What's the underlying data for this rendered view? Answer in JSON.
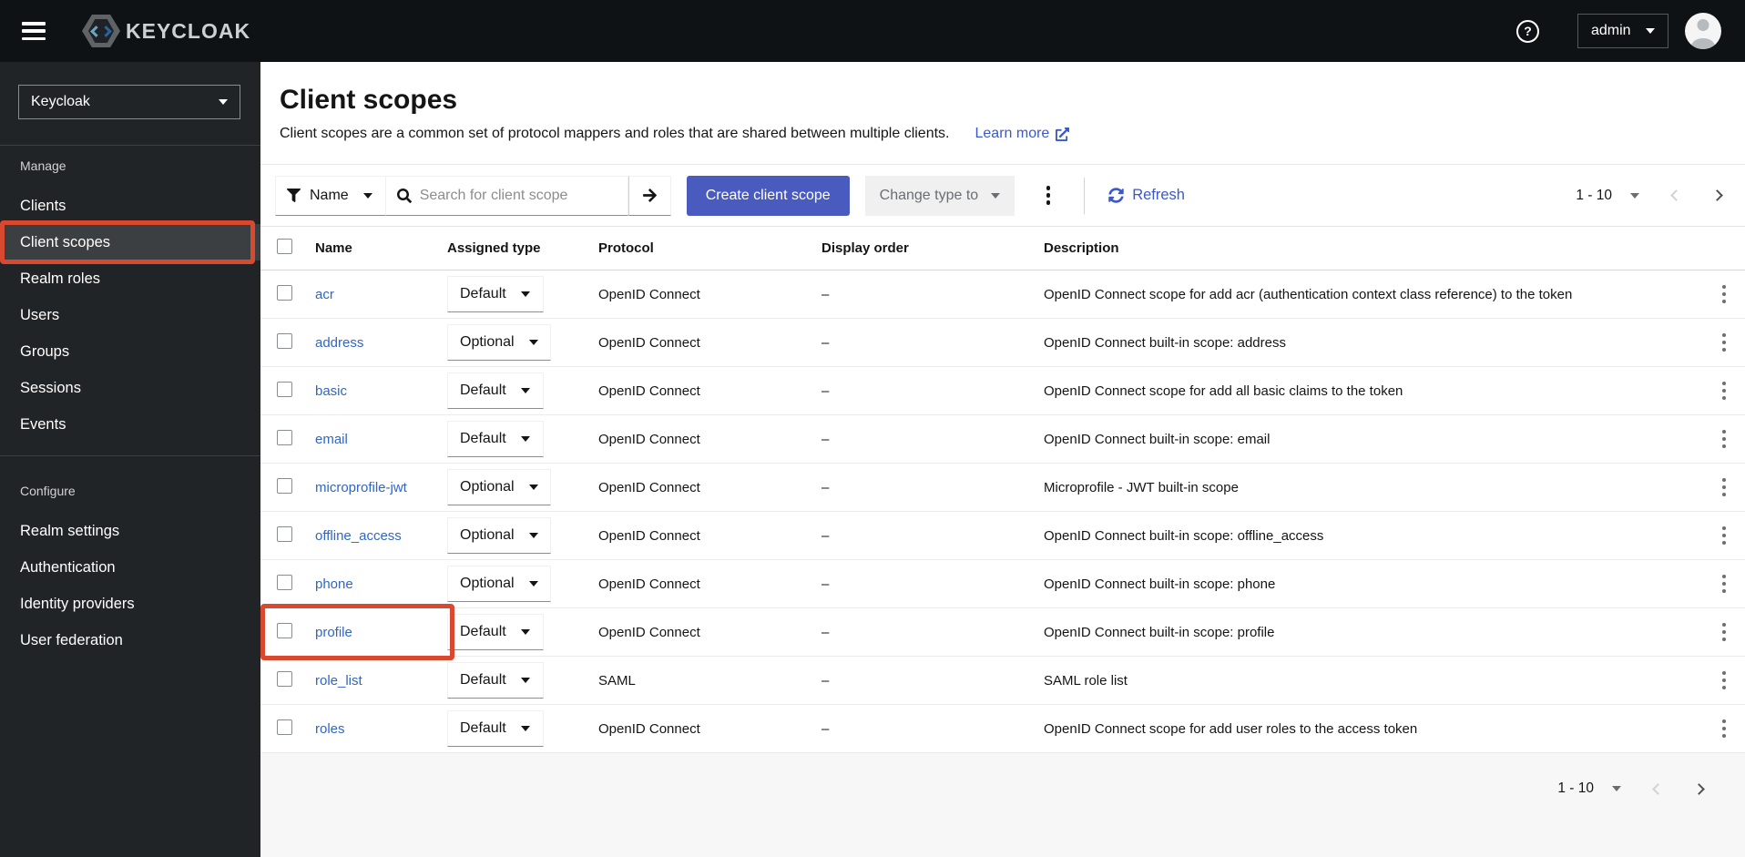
{
  "topbar": {
    "brand": "KEYCLOAK",
    "user": "admin"
  },
  "icons": {
    "nav_toggle": "hamburger",
    "help": "question-circle",
    "filter": "funnel",
    "search": "magnifier",
    "search_submit": "arrow-right",
    "refresh": "sync",
    "overflow": "kebab-vertical",
    "external_link": "external-link",
    "dropdown": "caret-down",
    "prev": "chevron-left",
    "next": "chevron-right"
  },
  "sidebar": {
    "realm": "Keycloak",
    "active_item": "Client scopes",
    "sections": [
      {
        "label": "Manage",
        "items": [
          "Clients",
          "Client scopes",
          "Realm roles",
          "Users",
          "Groups",
          "Sessions",
          "Events"
        ]
      },
      {
        "label": "Configure",
        "items": [
          "Realm settings",
          "Authentication",
          "Identity providers",
          "User federation"
        ]
      }
    ]
  },
  "header": {
    "title": "Client scopes",
    "description": "Client scopes are a common set of protocol mappers and roles that are shared between multiple clients.",
    "learn_more": "Learn more"
  },
  "toolbar": {
    "filter_label": "Name",
    "search_placeholder": "Search for client scope",
    "create_button": "Create client scope",
    "change_type_label": "Change type to",
    "refresh_label": "Refresh",
    "pagination_range": "1 - 10"
  },
  "table": {
    "columns": [
      "Name",
      "Assigned type",
      "Protocol",
      "Display order",
      "Description"
    ],
    "rows": [
      {
        "name": "acr",
        "type": "Default",
        "protocol": "OpenID Connect",
        "display_order": "–",
        "description": "OpenID Connect scope for add acr (authentication context class reference) to the token",
        "highlighted": false
      },
      {
        "name": "address",
        "type": "Optional",
        "protocol": "OpenID Connect",
        "display_order": "–",
        "description": "OpenID Connect built-in scope: address",
        "highlighted": false
      },
      {
        "name": "basic",
        "type": "Default",
        "protocol": "OpenID Connect",
        "display_order": "–",
        "description": "OpenID Connect scope for add all basic claims to the token",
        "highlighted": false
      },
      {
        "name": "email",
        "type": "Default",
        "protocol": "OpenID Connect",
        "display_order": "–",
        "description": "OpenID Connect built-in scope: email",
        "highlighted": false
      },
      {
        "name": "microprofile-jwt",
        "type": "Optional",
        "protocol": "OpenID Connect",
        "display_order": "–",
        "description": "Microprofile - JWT built-in scope",
        "highlighted": false
      },
      {
        "name": "offline_access",
        "type": "Optional",
        "protocol": "OpenID Connect",
        "display_order": "–",
        "description": "OpenID Connect built-in scope: offline_access",
        "highlighted": false
      },
      {
        "name": "phone",
        "type": "Optional",
        "protocol": "OpenID Connect",
        "display_order": "–",
        "description": "OpenID Connect built-in scope: phone",
        "highlighted": false
      },
      {
        "name": "profile",
        "type": "Default",
        "protocol": "OpenID Connect",
        "display_order": "–",
        "description": "OpenID Connect built-in scope: profile",
        "highlighted": true
      },
      {
        "name": "role_list",
        "type": "Default",
        "protocol": "SAML",
        "display_order": "–",
        "description": "SAML role list",
        "highlighted": false
      },
      {
        "name": "roles",
        "type": "Default",
        "protocol": "OpenID Connect",
        "display_order": "–",
        "description": "OpenID Connect scope for add user roles to the access token",
        "highlighted": false
      }
    ]
  },
  "footer": {
    "pagination_range": "1 - 10"
  },
  "colors": {
    "primary_button": "#4a5bc0",
    "link_blue": "#3266c2",
    "refresh_blue": "#3b59c9",
    "highlight_red": "#d9492f",
    "topbar_bg": "#0f1214",
    "sidebar_bg": "#212427",
    "sidebar_active_bg": "#3c3f42"
  }
}
